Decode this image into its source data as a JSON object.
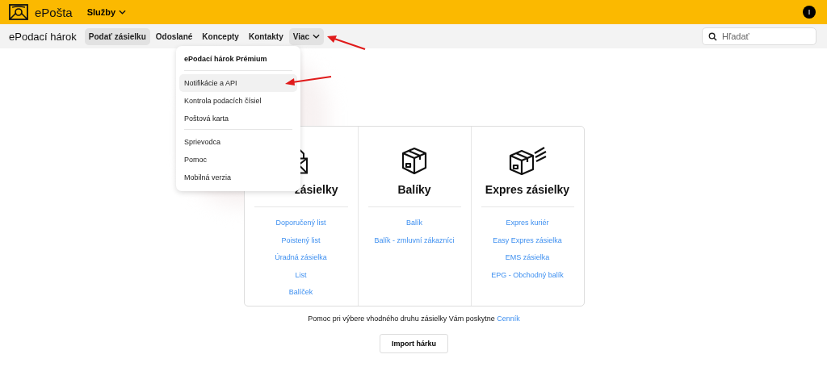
{
  "top_bar": {
    "logo_text": "ePošta",
    "services_menu": "Služby",
    "avatar": "I"
  },
  "nav": {
    "title": "ePodací hárok",
    "tabs": [
      {
        "label": "Podať zásielku",
        "selected": true
      },
      {
        "label": "Odoslané",
        "selected": false
      },
      {
        "label": "Koncepty",
        "selected": false
      },
      {
        "label": "Kontakty",
        "selected": false
      }
    ],
    "more": {
      "label": "Viac",
      "expanded": true
    },
    "search": {
      "placeholder": "Hľadať"
    }
  },
  "more_menu": {
    "header": "ePodací hárok Prémium",
    "groups": [
      [
        {
          "label": "Notifikácie a API",
          "selected": true
        },
        {
          "label": "Kontrola podacích čísiel",
          "selected": false
        },
        {
          "label": "Poštová karta",
          "selected": false
        }
      ],
      [
        {
          "label": "Sprievodca",
          "selected": false
        },
        {
          "label": "Pomoc",
          "selected": false
        },
        {
          "label": "Mobilná verzia",
          "selected": false
        }
      ]
    ]
  },
  "categories": [
    {
      "kind": "letter",
      "title": "zásielky",
      "links": [
        "Doporučený list",
        "Poistený list",
        "Úradná zásielka",
        "List",
        "Balíček"
      ]
    },
    {
      "kind": "parcel",
      "title": "Balíky",
      "links": [
        "Balík",
        "Balík - zmluvní zákazníci"
      ]
    },
    {
      "kind": "express",
      "title": "Expres zásielky",
      "links": [
        "Expres kuriér",
        "Easy Expres zásielka",
        "EMS zásielka",
        "EPG - Obchodný balík"
      ]
    }
  ],
  "help": {
    "text": "Pomoc pri výbere vhodného druhu zásielky Vám poskytne",
    "link": "Cenník"
  },
  "import_button": "Import hárku"
}
